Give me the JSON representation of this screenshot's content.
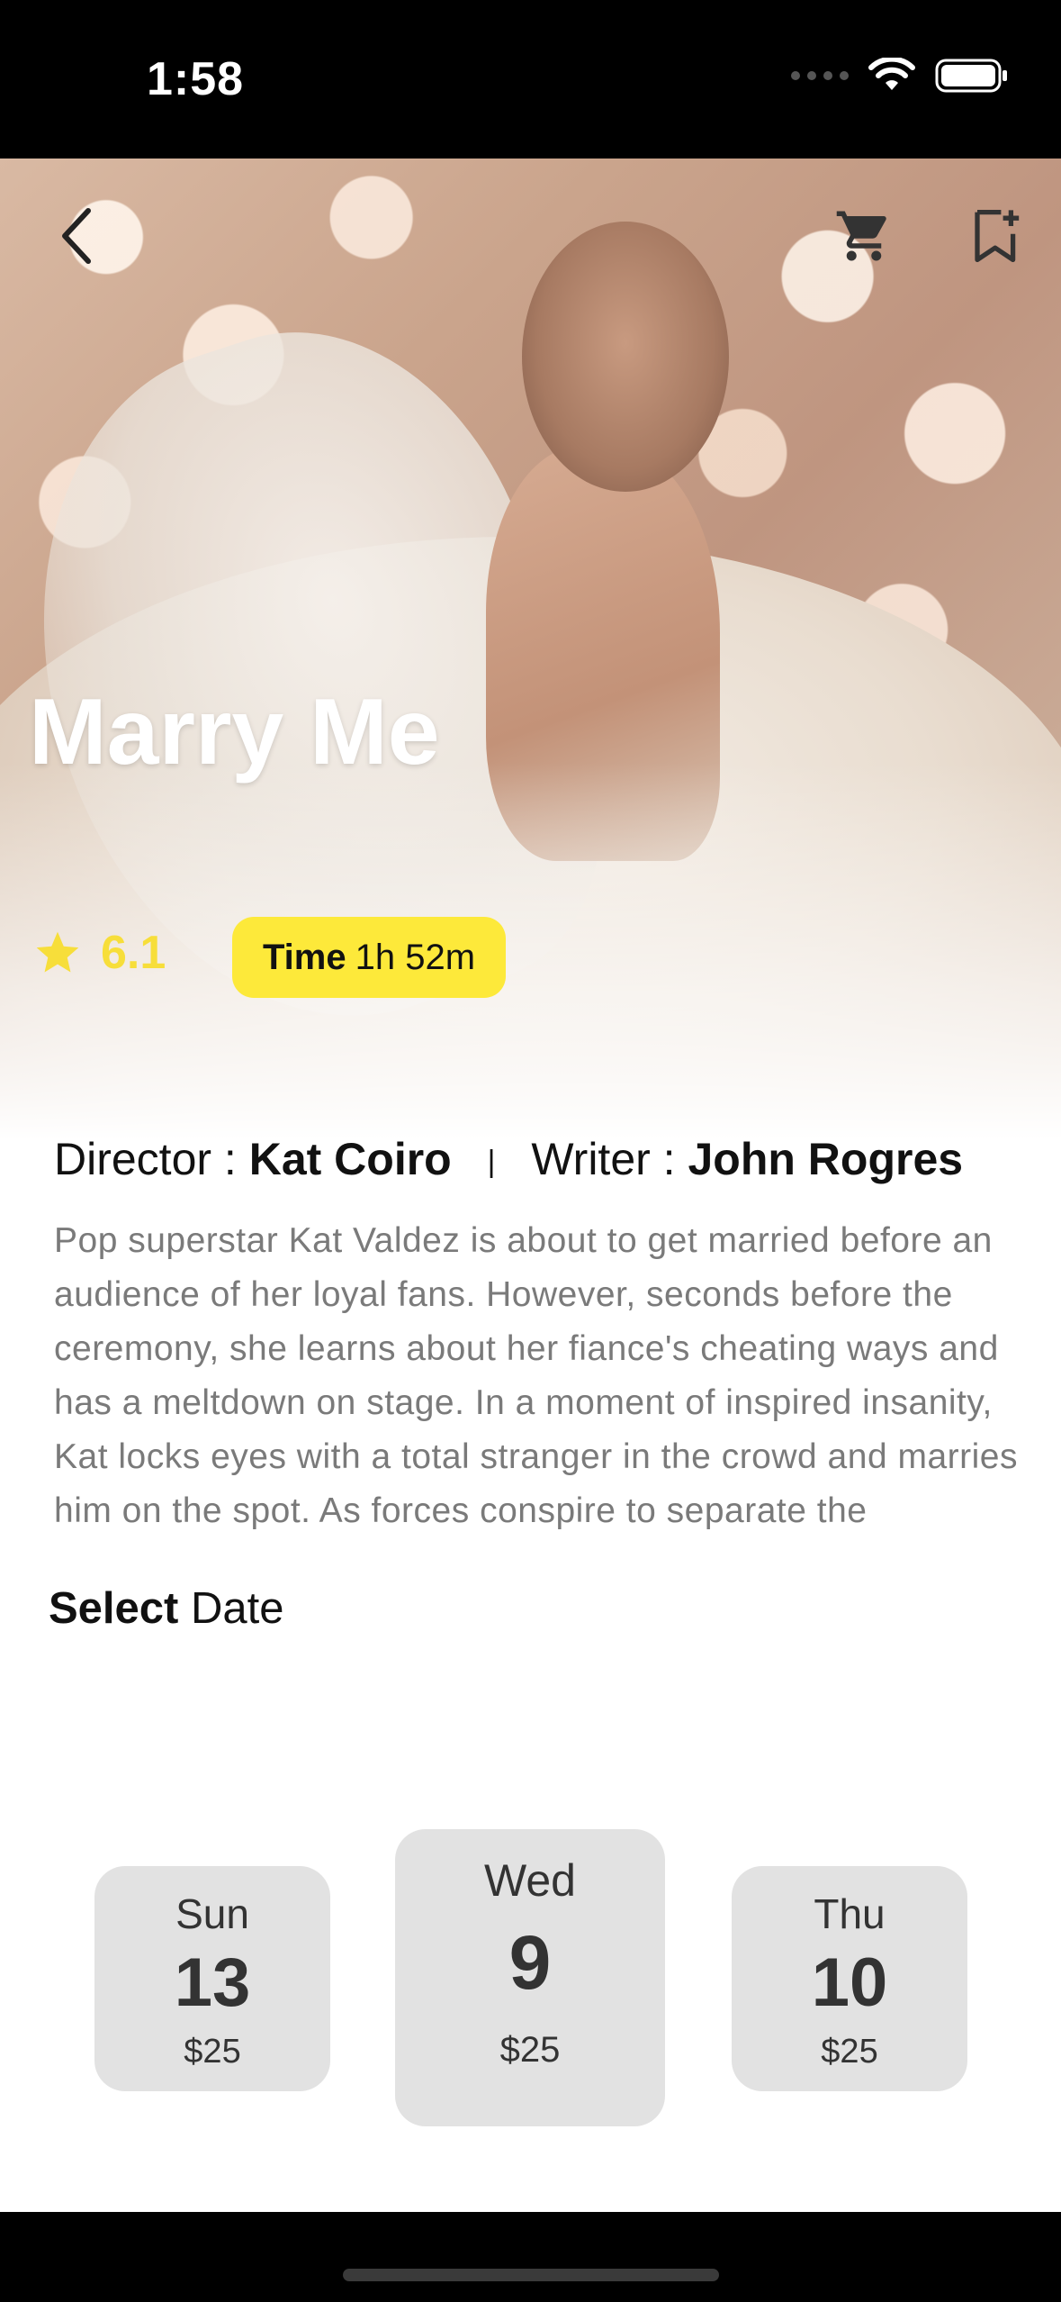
{
  "status_bar": {
    "time": "1:58"
  },
  "header": {
    "back_icon": "chevron-left-icon",
    "cart_icon": "cart-icon",
    "bookmark_icon": "bookmark-add-icon"
  },
  "movie": {
    "title": "Marry Me",
    "rating": "6.1",
    "time_label": "Time",
    "time_value": "1h 52m",
    "director_label": "Director :",
    "director": "Kat Coiro",
    "separator": "|",
    "writer_label": "Writer :",
    "writer": "John Rogres",
    "synopsis": "Pop superstar Kat Valdez is about to get married before an audience of her loyal fans. However, seconds before the ceremony, she learns about her fiance's cheating ways and has a meltdown on stage. In a moment of inspired insanity, Kat locks eyes with a total stranger in the crowd and marries him on the spot. As forces conspire to separate the"
  },
  "select_date": {
    "bold": "Select",
    "rest": "Date"
  },
  "dates": [
    {
      "day": "Sun",
      "num": "13",
      "price": "$25"
    },
    {
      "day": "Wed",
      "num": "9",
      "price": "$25"
    },
    {
      "day": "Thu",
      "num": "10",
      "price": "$25"
    }
  ],
  "colors": {
    "accent": "#FDE93A",
    "rating": "#F7DE3A",
    "card": "#E2E2E2"
  }
}
